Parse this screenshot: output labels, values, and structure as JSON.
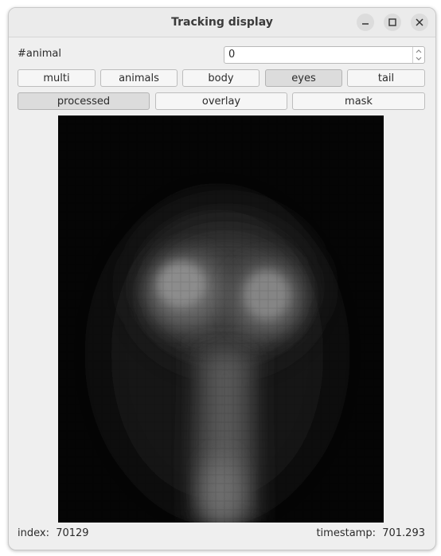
{
  "window": {
    "title": "Tracking display"
  },
  "animal_field": {
    "label": "#animal",
    "value": "0"
  },
  "view_buttons": [
    {
      "label": "multi",
      "active": false
    },
    {
      "label": "animals",
      "active": false
    },
    {
      "label": "body",
      "active": false
    },
    {
      "label": "eyes",
      "active": true
    },
    {
      "label": "tail",
      "active": false
    }
  ],
  "mode_buttons": [
    {
      "label": "processed",
      "active": true
    },
    {
      "label": "overlay",
      "active": false
    },
    {
      "label": "mask",
      "active": false
    }
  ],
  "status": {
    "index_label": "index:",
    "index_value": "70129",
    "timestamp_label": "timestamp:",
    "timestamp_value": "701.293"
  },
  "colors": {
    "background": "#efefef",
    "active_button": "#dcdcdc",
    "display_bg": "#050505"
  }
}
